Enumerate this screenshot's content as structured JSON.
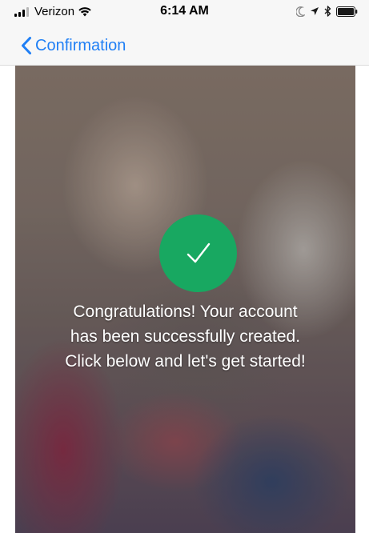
{
  "status_bar": {
    "carrier": "Verizon",
    "time": "6:14 AM",
    "icons": {
      "signal": "signal-bars-icon",
      "wifi": "wifi-icon",
      "moon": "moon-icon",
      "location": "location-arrow-icon",
      "bluetooth": "bluetooth-icon",
      "battery": "battery-icon"
    }
  },
  "nav": {
    "back_label": "Confirmation",
    "back_icon": "chevron-left-icon"
  },
  "main": {
    "check_icon": "checkmark-icon",
    "message_lines": [
      "Congratulations! Your account",
      "has been successfully created.",
      "Click below and let's get started!"
    ]
  },
  "colors": {
    "accent": "#1f7ff5",
    "success": "#18a861",
    "bar_background": "#f7f7f7",
    "text_on_image": "#ffffff"
  }
}
